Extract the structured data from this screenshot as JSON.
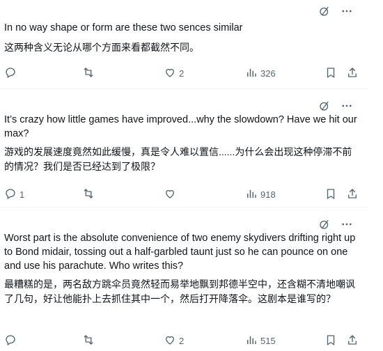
{
  "posts": [
    {
      "text": "In no way shape or form are these two sences similar",
      "translation": "这两种含义无论从哪个方面来看都截然不同。",
      "replies": "",
      "retweets": "",
      "likes": "2",
      "views": "326"
    },
    {
      "text": "It’s crazy how little games have improved...why the slowdown? Have we hit our max?",
      "translation": "游戏的发展速度竟然如此缓慢，真是令人难以置信......为什么会出现这种停滞不前的情况？我们是否已经达到了极限？",
      "replies": "1",
      "retweets": "",
      "likes": "",
      "views": "918"
    },
    {
      "text": "Worst part is the absolute convenience of two enemy skydivers drifting right up to Bond midair, tossing out a half-garbled taunt just so he can pounce on one and use his parachute. Who writes this?",
      "translation": "最糟糕的是，两名敌方跳伞员竟然轻而易举地飘到邦德半空中，还含糊不清地嘲讽了几句，好让他能扑上去抓住其中一个，然后打开降落伞。这剧本是谁写的？",
      "replies": "",
      "retweets": "",
      "likes": "2",
      "views": "515"
    }
  ],
  "icons": {
    "grok": "grok-slash-icon",
    "more": "more-horizontal-icon",
    "reply": "reply-bubble-icon",
    "retweet": "retweet-icon",
    "like": "heart-icon",
    "views": "bar-chart-icon",
    "bookmark": "bookmark-icon",
    "share": "share-upload-icon"
  },
  "colors": {
    "text": "#0f1419",
    "muted": "#536471",
    "divider": "#eff3f4"
  }
}
